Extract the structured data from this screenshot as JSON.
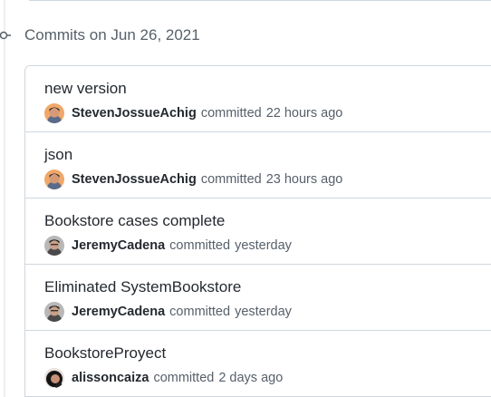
{
  "group": {
    "heading": "Commits on Jun 26, 2021"
  },
  "commits": [
    {
      "message": "new version",
      "author": "StevenJossueAchig",
      "action": "committed",
      "time": "22 hours ago",
      "avatar": "avatar-steven"
    },
    {
      "message": "json",
      "author": "StevenJossueAchig",
      "action": "committed",
      "time": "23 hours ago",
      "avatar": "avatar-steven"
    },
    {
      "message": "Bookstore cases complete",
      "author": "JeremyCadena",
      "action": "committed",
      "time": "yesterday",
      "avatar": "avatar-jeremy"
    },
    {
      "message": "Eliminated SystemBookstore",
      "author": "JeremyCadena",
      "action": "committed",
      "time": "yesterday",
      "avatar": "avatar-jeremy"
    },
    {
      "message": "BookstoreProyect",
      "author": "alissoncaiza",
      "action": "committed",
      "time": "2 days ago",
      "avatar": "avatar-alisson"
    }
  ],
  "colors": {
    "border": "#d0d7de",
    "text_primary": "#24292f",
    "text_muted": "#57606a"
  },
  "icons": {
    "timeline": "git-commit-icon"
  }
}
